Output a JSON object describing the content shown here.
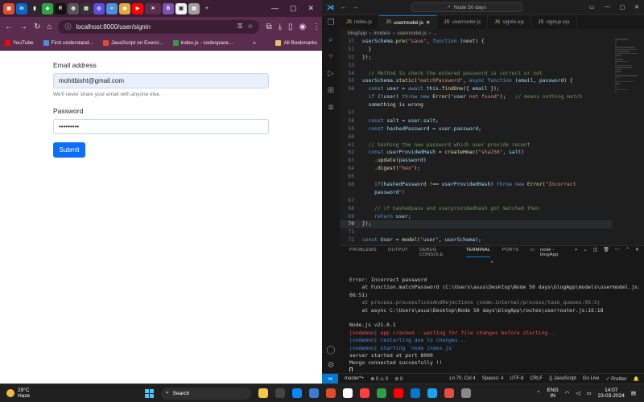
{
  "chrome": {
    "tabs": [
      {
        "glyph": "▣",
        "color": "#e04c2c"
      },
      {
        "glyph": "in",
        "color": "#0a66c2"
      },
      {
        "glyph": "▮",
        "color": "#2a2a2a"
      },
      {
        "glyph": "◆",
        "color": "#28a745"
      },
      {
        "glyph": "R",
        "color": "#111111"
      },
      {
        "glyph": "◍",
        "color": "#555555"
      },
      {
        "glyph": "▤",
        "color": "#333333"
      },
      {
        "glyph": "◎",
        "color": "#5f4bdb"
      },
      {
        "glyph": "≈",
        "color": "#4a90d9"
      },
      {
        "glyph": "◉",
        "color": "#e1a93b"
      },
      {
        "glyph": "▶",
        "color": "#ff0000"
      },
      {
        "glyph": "✕",
        "color": "#5a2d4e"
      },
      {
        "glyph": "B",
        "color": "#7952b3"
      },
      {
        "glyph": "▣",
        "color": "#f0f0f0"
      },
      {
        "glyph": "▤",
        "color": "#9e9e9e"
      }
    ],
    "new_tab": "+",
    "url": "localhost:8000/user/signin",
    "bookmarks": [
      {
        "label": "YouTube",
        "color": "#ff0000"
      },
      {
        "label": "First understand...",
        "color": "#4a90d9"
      },
      {
        "label": "JavaScript on Exerci...",
        "color": "#e04c2c"
      },
      {
        "label": "index.js - codespace...",
        "color": "#2ea043"
      }
    ],
    "all_bookmarks": "All Bookmarks"
  },
  "form": {
    "email_label": "Email address",
    "email_value": "mohitbisht@gmail.com",
    "email_help": "We'll never share your email with anyone else.",
    "password_label": "Password",
    "password_value": "•••••••••",
    "submit_label": "Submit"
  },
  "vscode": {
    "search": "Node 50 days",
    "tabs": [
      {
        "label": "index.js",
        "active": false
      },
      {
        "label": "usermodel.js",
        "active": true
      },
      {
        "label": "userrouter.js",
        "active": false
      },
      {
        "label": "signin.ejs",
        "active": false
      },
      {
        "label": "signup.ejs",
        "active": false
      }
    ],
    "breadcrumb": [
      "blogApp",
      "models",
      "usermodel.js",
      "..."
    ],
    "code": [
      {
        "n": "37",
        "t": "userSchema.pre(\"save\", function (next) {"
      },
      {
        "n": "51",
        "t": "  }"
      },
      {
        "n": "52",
        "t": "});"
      },
      {
        "n": "53",
        "t": ""
      },
      {
        "n": "54",
        "t": "  // Method to check the entered password is correct or not"
      },
      {
        "n": "55",
        "t": "userSchema.static(\"matchPassword\", async function (email, password) {"
      },
      {
        "n": "56",
        "t": "  const user = await this.findOne({ email });"
      },
      {
        "n": "",
        "t": "  if (!user) throw new Error(\"user not found\");   // means nothing match"
      },
      {
        "n": "",
        "t": "  something is wrong"
      },
      {
        "n": "57",
        "t": ""
      },
      {
        "n": "58",
        "t": "  const salt = user.salt;"
      },
      {
        "n": "59",
        "t": "  const hashedPassword = user.password;"
      },
      {
        "n": "60",
        "t": ""
      },
      {
        "n": "61",
        "t": "  // hashing the new password which user provide recent"
      },
      {
        "n": "62",
        "t": "  const userProvidedHash = createHmac(\"sha256\", salt)"
      },
      {
        "n": "63",
        "t": "    .update(password)"
      },
      {
        "n": "64",
        "t": "    .digest(\"hex\");"
      },
      {
        "n": "65",
        "t": ""
      },
      {
        "n": "66",
        "t": "    if(hashedPassword !== userProvidedHash) throw new Error(\"Incorrect"
      },
      {
        "n": "",
        "t": "    password\")"
      },
      {
        "n": "67",
        "t": ""
      },
      {
        "n": "68",
        "t": "    // if hashedpass and userprovidedhash got matched then"
      },
      {
        "n": "69",
        "t": "    return user;"
      },
      {
        "n": "70",
        "t": "});"
      },
      {
        "n": "71",
        "t": ""
      },
      {
        "n": "72",
        "t": "const User = model(\"user\", userSchema);"
      },
      {
        "n": "73",
        "t": ""
      }
    ],
    "current_line": "70",
    "panel_tabs": [
      {
        "label": "PROBLEMS",
        "active": false
      },
      {
        "label": "OUTPUT",
        "active": false
      },
      {
        "label": "DEBUG CONSOLE",
        "active": false
      },
      {
        "label": "TERMINAL",
        "active": true
      },
      {
        "label": "PORTS",
        "active": false
      }
    ],
    "terminal_name": "node - blogApp",
    "terminal": [
      {
        "t": "Error: Incorrect password",
        "c": ""
      },
      {
        "t": "    at Function.matchPassword (C:\\Users\\asus\\Desktop\\Node 50 days\\blogApp\\models\\usermodel.js:",
        "c": ""
      },
      {
        "t": "66:51)",
        "c": ""
      },
      {
        "t": "    at process.processTicksAndRejections (node:internal/process/task_queues:95:5)",
        "c": "t-dim"
      },
      {
        "t": "    at async C:\\Users\\asus\\Desktop\\Node 50 days\\blogApp\\routes\\userrouter.js:16:18",
        "c": ""
      },
      {
        "t": "",
        "c": ""
      },
      {
        "t": "Node.js v21.6.1",
        "c": ""
      },
      {
        "t": "[nodemon] app crashed - waiting for file changes before starting...",
        "c": "t-red"
      },
      {
        "t": "[nodemon] restarting due to changes...",
        "c": "t-blue"
      },
      {
        "t": "[nodemon] starting `node index.js`",
        "c": "t-blue"
      },
      {
        "t": "server started at port 8000",
        "c": ""
      },
      {
        "t": "Mongo connected succesfully !!",
        "c": ""
      }
    ],
    "status": {
      "branch": "master*+",
      "problems": "⊗ 0 ⚠ 0",
      "ports": "⊘ 0",
      "position": "Ln 70, Col 4",
      "spaces": "Spaces: 4",
      "encoding": "UTF-8",
      "eol": "CRLF",
      "language": "{} JavaScript",
      "golive": "Go Live",
      "prettier": "✓ Prettier"
    }
  },
  "taskbar": {
    "temp": "29°C",
    "weather": "Haze",
    "search": "Search",
    "apps": [
      "#f2c744",
      "#444444",
      "#0a84ff",
      "#3a7bd5",
      "#e04c2c",
      "#ffffff",
      "#ff4040",
      "#2ea043",
      "#ff0000",
      "#0078d4",
      "#1da1f2",
      "#e74c3c",
      "#888888"
    ],
    "lang1": "ENG",
    "lang2": "IN",
    "time": "14:07",
    "date": "23-03-2024"
  }
}
